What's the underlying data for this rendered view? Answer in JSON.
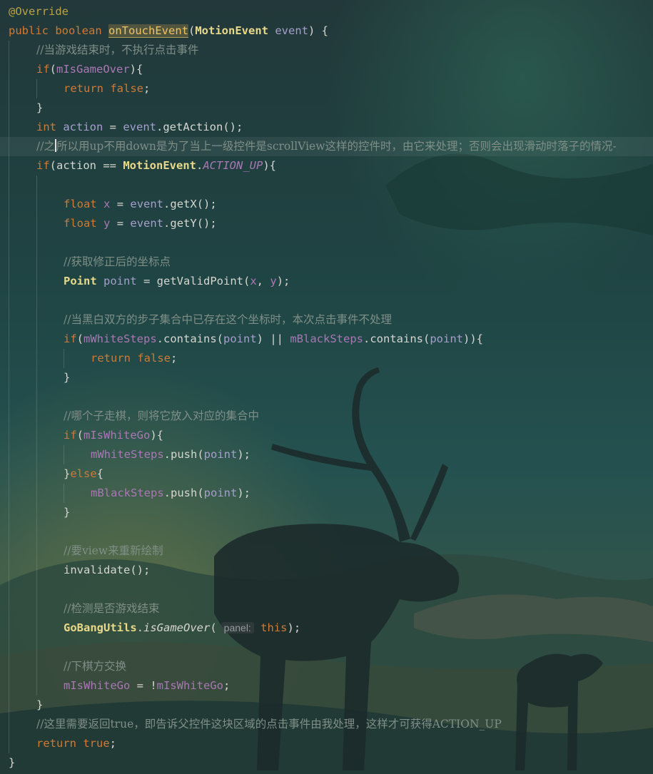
{
  "editor": {
    "language": "Java",
    "font": "monospace",
    "colors": {
      "background": "#1d3c3d",
      "keyword": "#cf7a35",
      "comment": "#7f8f87",
      "method_highlight": "#eec45f",
      "class": "#e8d98a",
      "member": "#a978b4",
      "parameter": "#a59fcb",
      "annotation": "#b9a247"
    },
    "code": {
      "annotation": "@Override",
      "sig_public": "public",
      "sig_boolean": "boolean",
      "sig_method": "onTouchEvent",
      "sig_open": "(",
      "sig_type": "MotionEvent",
      "sig_param": "event",
      "sig_close": ") {",
      "c1": "//当游戏结束时，不执行点击事件",
      "if1_kw": "if",
      "if1_open": "(",
      "if1_var": "mIsGameOver",
      "if1_close": "){",
      "ret_kw": "return",
      "false_kw": "false",
      "semi": ";",
      "brace": "}",
      "int_kw": "int",
      "action_var": "action",
      "assign": " = ",
      "event_var": "event",
      "get_action": ".getAction();",
      "c2a": "//之",
      "c2b": "所以用up不用down是为了当上一级控件是scrollView这样的控件时，由它来处理；否则会出现滑动时落子的情况-",
      "if2_kw": "if",
      "if2_open": "(action == ",
      "motion_event": "MotionEvent",
      "dot": ".",
      "action_up": "ACTION_UP",
      "if2_close": "){",
      "float_kw": "float",
      "x_var": "x",
      "y_var": "y",
      "get_x": ".getX();",
      "get_y": ".getY();",
      "c3": "//获取修正后的坐标点",
      "point_cls": "Point",
      "point_var": "point",
      "get_valid": " = getValidPoint(",
      "comma": ", ",
      "close_semi": ");",
      "c4": "//当黑白双方的步子集合中已存在这个坐标时，本次点击事件不处理",
      "if3_kw": "if",
      "if3_open": "(",
      "white_steps": "mWhiteSteps",
      "contains": ".contains(",
      "or_sep": ") || ",
      "black_steps": "mBlackSteps",
      "if3_close": ")){",
      "c5": "//哪个子走棋，则将它放入对应的集合中",
      "if4_kw": "if",
      "if4_open": "(",
      "is_white_go": "mIsWhiteGo",
      "if4_close": "){",
      "push": ".push(",
      "else_open": "}",
      "else_kw": "else",
      "else_close": "{",
      "c6": "//要view来重新绘制",
      "invalidate": "invalidate();",
      "c7": "//检测是否游戏结束",
      "gobang_utils": "GoBangUtils",
      "is_game_over": "isGameOver",
      "paren_open": "(",
      "hint_panel": "panel:",
      "this_kw": "this",
      "c8": "//下棋方交换",
      "not_assign": " = !",
      "c9": "//这里需要返回true，即告诉父控件这块区域的点击事件由我处理，这样才可获得ACTION_UP",
      "true_kw": "true"
    }
  }
}
